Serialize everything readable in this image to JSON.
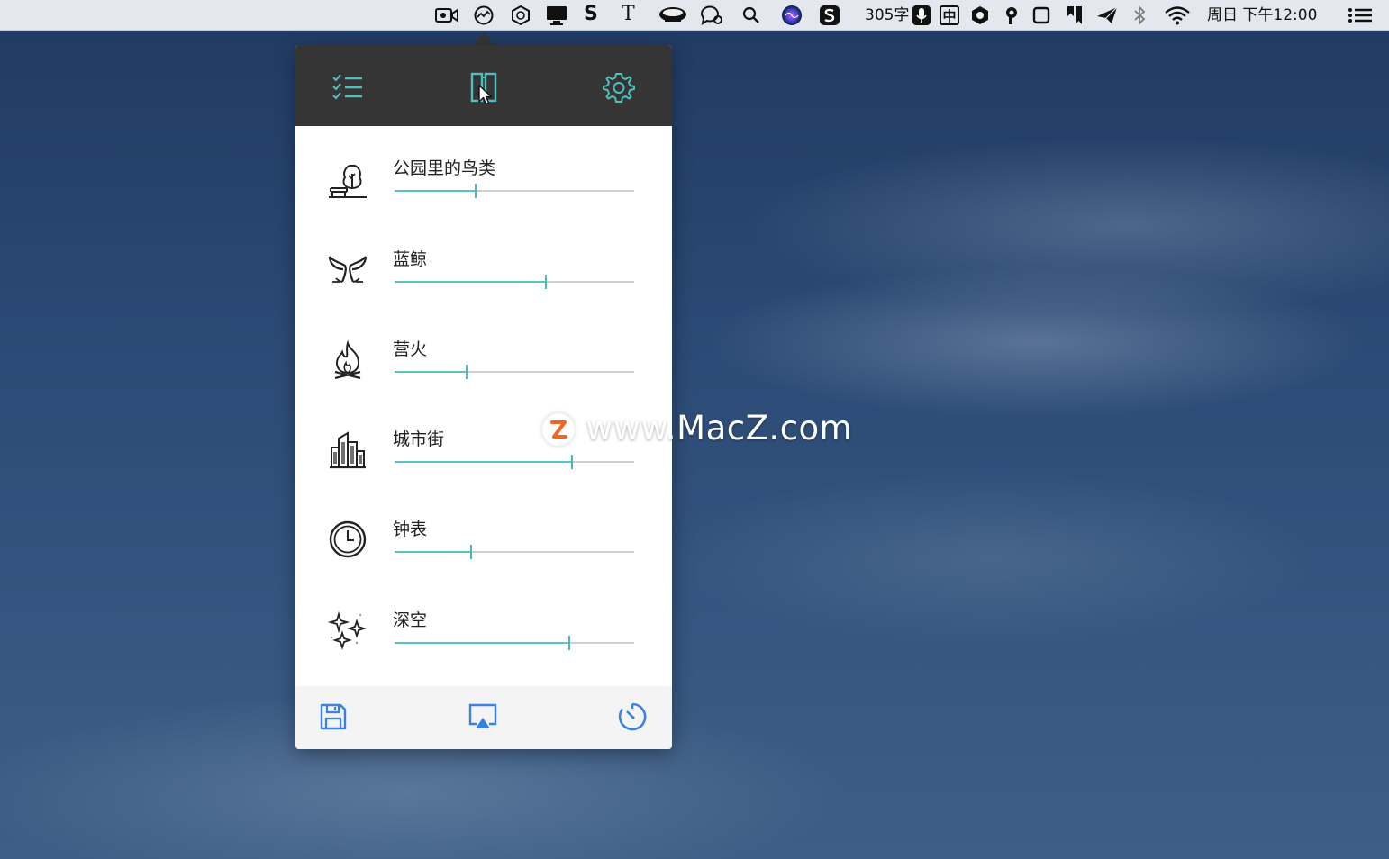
{
  "menubar": {
    "word_count": "305字",
    "input_method": "中",
    "datetime": "周日 下午12:00",
    "status_icons": [
      "screen-record-icon",
      "activity-monitor-icon",
      "cube-icon",
      "display-icon",
      "s-app-icon",
      "t-app-icon",
      "coffee-cup-icon",
      "chat-bubbles-icon",
      "spotlight-search-icon",
      "siri-icon",
      "sogou-icon",
      "microphone-icon",
      "input-method-icon",
      "hexagon-icon",
      "p-icon",
      "square-icon",
      "bookmark-icon",
      "paper-plane-icon",
      "bluetooth-icon",
      "wifi-icon",
      "notification-center-icon"
    ]
  },
  "popover": {
    "header_tabs": [
      "checklist-icon",
      "sound-panel-icon",
      "settings-gear-icon"
    ],
    "sounds": [
      {
        "label": "公园里的鸟类",
        "icon": "park-tree-icon",
        "level": 0.34
      },
      {
        "label": "蓝鲸",
        "icon": "whale-tail-icon",
        "level": 0.63
      },
      {
        "label": "营火",
        "icon": "campfire-icon",
        "level": 0.3
      },
      {
        "label": "城市街",
        "icon": "city-buildings-icon",
        "level": 0.74
      },
      {
        "label": "钟表",
        "icon": "clock-icon",
        "level": 0.32
      },
      {
        "label": "深空",
        "icon": "sparkles-icon",
        "level": 0.73
      }
    ],
    "footer_buttons": [
      "save-icon",
      "airplay-icon",
      "timer-icon"
    ],
    "accent_color": "#5ec2c2",
    "footer_icon_color": "#3b82e0"
  },
  "watermark": {
    "text": "www.MacZ.com",
    "logo_letter": "Z"
  }
}
